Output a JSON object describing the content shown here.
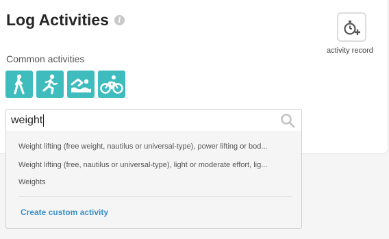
{
  "header": {
    "title": "Log Activities",
    "info_icon": "info-icon"
  },
  "record": {
    "label": "activity record",
    "icon": "stopwatch-plus-icon"
  },
  "common": {
    "label": "Common activities",
    "items": [
      {
        "icon": "walking-icon"
      },
      {
        "icon": "running-icon"
      },
      {
        "icon": "swimming-icon"
      },
      {
        "icon": "cycling-icon"
      }
    ],
    "accent_color": "#3ebcbe"
  },
  "search": {
    "value": "weight",
    "icon": "search-icon"
  },
  "results": [
    "Weight lifting (free weight, nautilus or universal-type), power lifting or bod...",
    "Weight lifting (free, nautilus or universal-type), light or moderate effort, lig...",
    "Weights"
  ],
  "custom_activity": {
    "label": "Create custom activity",
    "color": "#3a8fc7"
  }
}
